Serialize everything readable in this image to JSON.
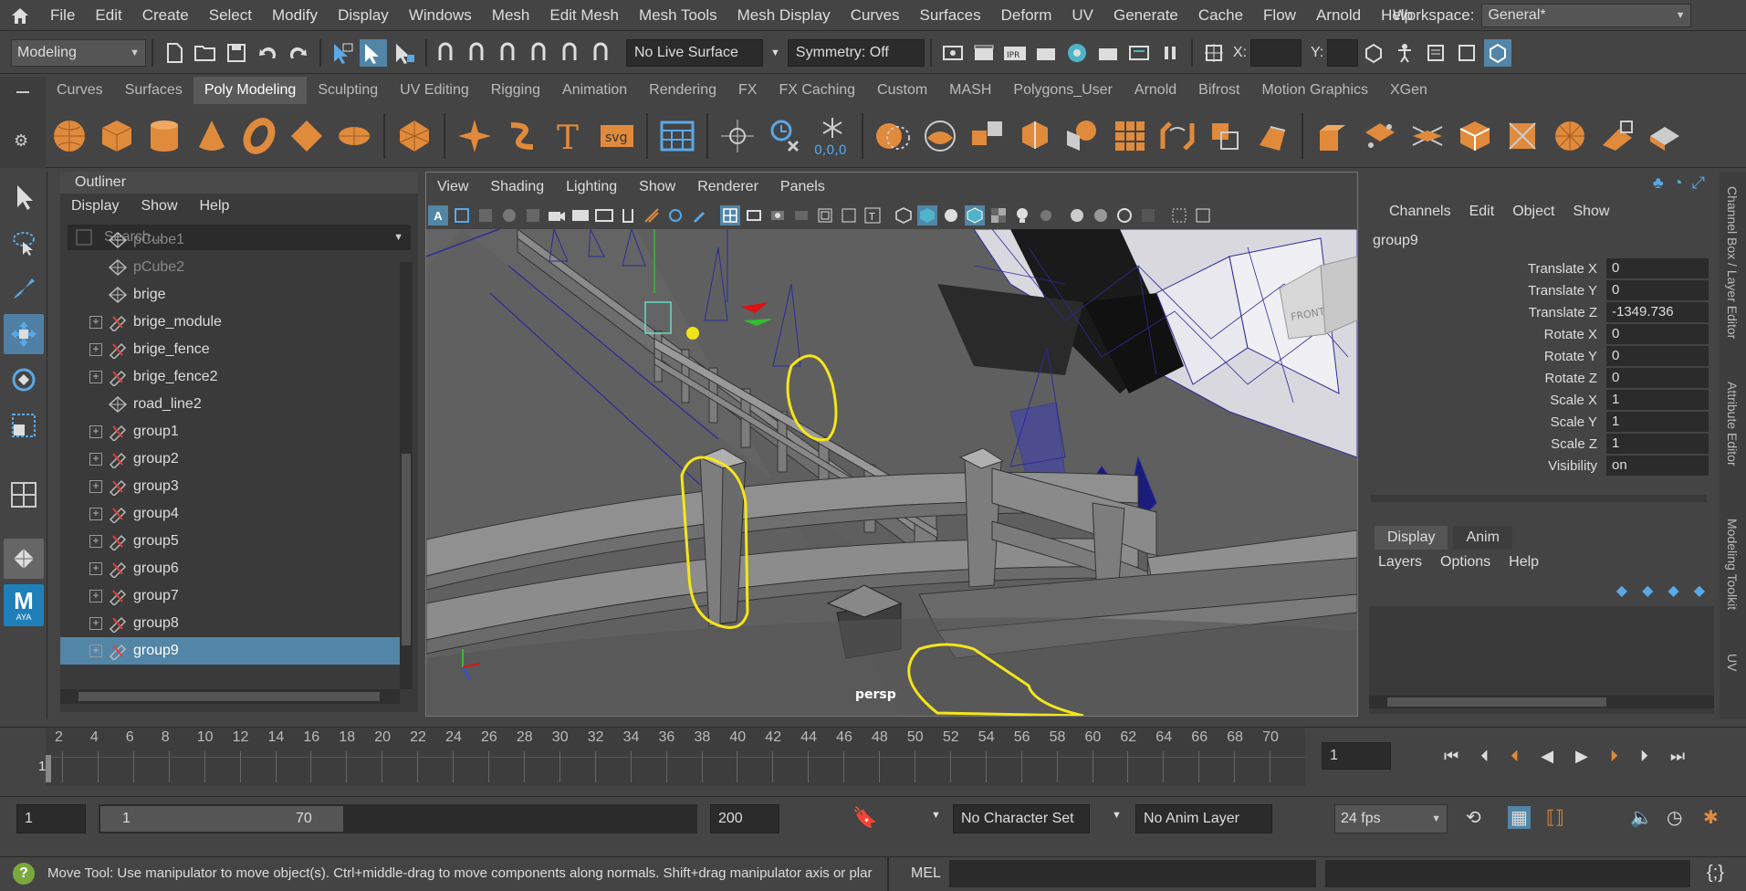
{
  "menubar": {
    "items": [
      "File",
      "Edit",
      "Create",
      "Select",
      "Modify",
      "Display",
      "Windows",
      "Mesh",
      "Edit Mesh",
      "Mesh Tools",
      "Mesh Display",
      "Curves",
      "Surfaces",
      "Deform",
      "UV",
      "Generate",
      "Cache",
      "Flow",
      "Arnold",
      "Help"
    ],
    "workspace_label": "Workspace:",
    "workspace_value": "General*"
  },
  "statusline": {
    "mode": "Modeling",
    "live_surface": "No Live Surface",
    "symmetry": "Symmetry: Off",
    "x_label": "X:",
    "y_label": "Y:"
  },
  "shelf": {
    "tabs": [
      "Curves",
      "Surfaces",
      "Poly Modeling",
      "Sculpting",
      "UV Editing",
      "Rigging",
      "Animation",
      "Rendering",
      "FX",
      "FX Caching",
      "Custom",
      "MASH",
      "Polygons_User",
      "Arnold",
      "Bifrost",
      "Motion Graphics",
      "XGen"
    ],
    "active_tab": 2,
    "svg_label": "svg",
    "snap_label": "0,0,0"
  },
  "outliner": {
    "title": "Outliner",
    "menu": [
      "Display",
      "Show",
      "Help"
    ],
    "search_placeholder": "Search...",
    "items": [
      {
        "name": "pCube1",
        "type": "mesh",
        "expandable": false,
        "dim": true
      },
      {
        "name": "pCube2",
        "type": "mesh",
        "expandable": false,
        "dim": true
      },
      {
        "name": "brige",
        "type": "mesh",
        "expandable": false,
        "dim": false
      },
      {
        "name": "brige_module",
        "type": "group",
        "expandable": true,
        "dim": false
      },
      {
        "name": "brige_fence",
        "type": "group",
        "expandable": true,
        "dim": false
      },
      {
        "name": "brige_fence2",
        "type": "group",
        "expandable": true,
        "dim": false
      },
      {
        "name": "road_line2",
        "type": "mesh",
        "expandable": false,
        "dim": false
      },
      {
        "name": "group1",
        "type": "group",
        "expandable": true,
        "dim": false
      },
      {
        "name": "group2",
        "type": "group",
        "expandable": true,
        "dim": false
      },
      {
        "name": "group3",
        "type": "group",
        "expandable": true,
        "dim": false
      },
      {
        "name": "group4",
        "type": "group",
        "expandable": true,
        "dim": false
      },
      {
        "name": "group5",
        "type": "group",
        "expandable": true,
        "dim": false
      },
      {
        "name": "group6",
        "type": "group",
        "expandable": true,
        "dim": false
      },
      {
        "name": "group7",
        "type": "group",
        "expandable": true,
        "dim": false
      },
      {
        "name": "group8",
        "type": "group",
        "expandable": true,
        "dim": false
      },
      {
        "name": "group9",
        "type": "group",
        "expandable": true,
        "dim": false,
        "selected": true
      }
    ]
  },
  "viewport": {
    "menu": [
      "View",
      "Shading",
      "Lighting",
      "Show",
      "Renderer",
      "Panels"
    ],
    "camera_label": "persp",
    "viewcube_label": "FRONT"
  },
  "channelbox": {
    "menu": [
      "Channels",
      "Edit",
      "Object",
      "Show"
    ],
    "object": "group9",
    "attributes": [
      {
        "name": "Translate X",
        "value": "0"
      },
      {
        "name": "Translate Y",
        "value": "0"
      },
      {
        "name": "Translate Z",
        "value": "-1349.736"
      },
      {
        "name": "Rotate X",
        "value": "0"
      },
      {
        "name": "Rotate Y",
        "value": "0"
      },
      {
        "name": "Rotate Z",
        "value": "0"
      },
      {
        "name": "Scale X",
        "value": "1"
      },
      {
        "name": "Scale Y",
        "value": "1"
      },
      {
        "name": "Scale Z",
        "value": "1"
      },
      {
        "name": "Visibility",
        "value": "on"
      }
    ],
    "layer_tabs": [
      "Display",
      "Anim"
    ],
    "layer_menu": [
      "Layers",
      "Options",
      "Help"
    ],
    "side_tabs": [
      "Channel Box / Layer Editor",
      "Attribute Editor",
      "Modeling Toolkit",
      "UV"
    ]
  },
  "timeslider": {
    "ticks": [
      "2",
      "4",
      "6",
      "8",
      "10",
      "12",
      "14",
      "16",
      "18",
      "20",
      "22",
      "24",
      "26",
      "28",
      "30",
      "32",
      "34",
      "36",
      "38",
      "40",
      "42",
      "44",
      "46",
      "48",
      "50",
      "52",
      "54",
      "56",
      "58",
      "60",
      "62",
      "64",
      "66",
      "68",
      "70"
    ],
    "current_marker": "1",
    "current_frame": "1"
  },
  "range": {
    "start": "1",
    "inner_start": "1",
    "inner_end": "70",
    "end": "200",
    "character_set": "No Character Set",
    "anim_layer": "No Anim Layer",
    "fps": "24 fps"
  },
  "helpline": {
    "text": "Move Tool: Use manipulator to move object(s). Ctrl+middle-drag to move components along normals. Shift+drag manipulator axis or plar",
    "mel_label": "MEL"
  },
  "logo": {
    "letter": "M",
    "sub": "AYA"
  },
  "colors": {
    "accent_orange": "#e08a3c",
    "selection_blue": "#5285a6",
    "annotation_yellow": "#f4e61a"
  }
}
